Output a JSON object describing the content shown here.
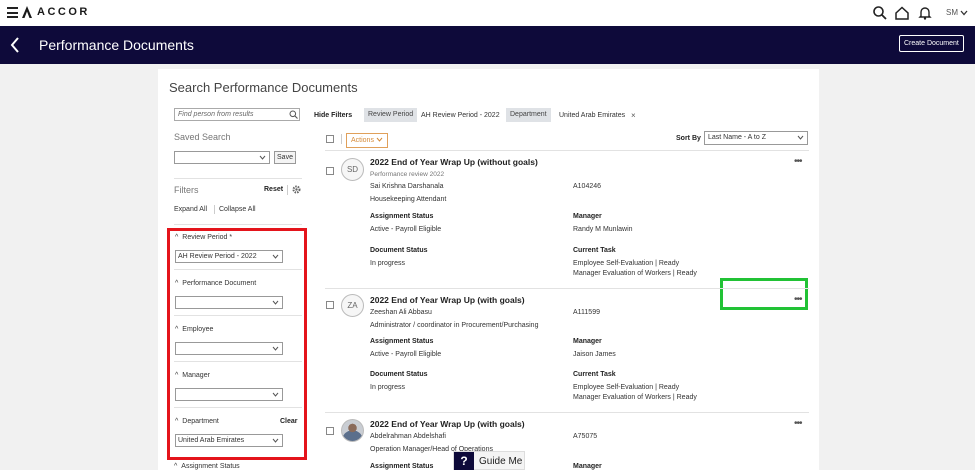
{
  "app": {
    "brand": "ACCOR",
    "user_initials": "SM"
  },
  "header": {
    "title": "Performance Documents",
    "create_label": "Create Document"
  },
  "search": {
    "title": "Search Performance Documents",
    "find_placeholder": "Find person from results",
    "saved_search_label": "Saved Search",
    "save_label": "Save",
    "filters_label": "Filters",
    "reset_label": "Reset",
    "expand_all": "Expand All",
    "collapse_all": "Collapse All",
    "hide_filters": "Hide Filters"
  },
  "filters": {
    "review_period": {
      "label": "Review Period *",
      "value": "AH Review Period - 2022"
    },
    "performance_document": {
      "label": "Performance Document",
      "value": ""
    },
    "employee": {
      "label": "Employee",
      "value": ""
    },
    "manager": {
      "label": "Manager",
      "value": ""
    },
    "department": {
      "label": "Department",
      "value": "United Arab Emirates",
      "clear_label": "Clear"
    },
    "assignment_status": {
      "label": "Assignment Status"
    }
  },
  "chips": [
    {
      "label": "Review Period",
      "value": "AH Review Period - 2022"
    },
    {
      "label": "Department",
      "value": "United Arab Emirates"
    }
  ],
  "toolbar": {
    "actions_label": "Actions",
    "sort_by_label": "Sort By",
    "sort_value": "Last Name - A to Z"
  },
  "labels": {
    "assignment_status": "Assignment Status",
    "manager": "Manager",
    "document_status": "Document Status",
    "current_task": "Current Task"
  },
  "documents": [
    {
      "initials": "SD",
      "title": "2022 End of Year Wrap Up (without goals)",
      "subtitle": "Performance review 2022",
      "name": "Sai Krishna Darshanala",
      "job": "Housekeeping Attendant",
      "id": "A104246",
      "assignment_status": "Active - Payroll Eligible",
      "manager": "Randy M Munlawin",
      "document_status": "In progress",
      "tasks": [
        "Employee Self-Evaluation | Ready",
        "Manager Evaluation of Workers | Ready"
      ]
    },
    {
      "initials": "ZA",
      "title": "2022 End of Year Wrap Up (with goals)",
      "name": "Zeeshan Ali Abbasu",
      "job": "Administrator / coordinator in Procurement/Purchasing",
      "id": "A111599",
      "assignment_status": "Active - Payroll Eligible",
      "manager": "Jaison James",
      "document_status": "In progress",
      "tasks": [
        "Employee Self-Evaluation | Ready",
        "Manager Evaluation of Workers | Ready"
      ]
    },
    {
      "title": "2022 End of Year Wrap Up (with goals)",
      "name": "Abdelrahman Abdelshafi",
      "job": "Operation Manager/Head of Operations",
      "id": "A75075"
    }
  ],
  "guide": {
    "icon": "?",
    "label": "Guide Me"
  },
  "highlight_colors": {
    "red": "#e4141b",
    "green": "#21c235",
    "header_bg": "#0e0a3a"
  }
}
